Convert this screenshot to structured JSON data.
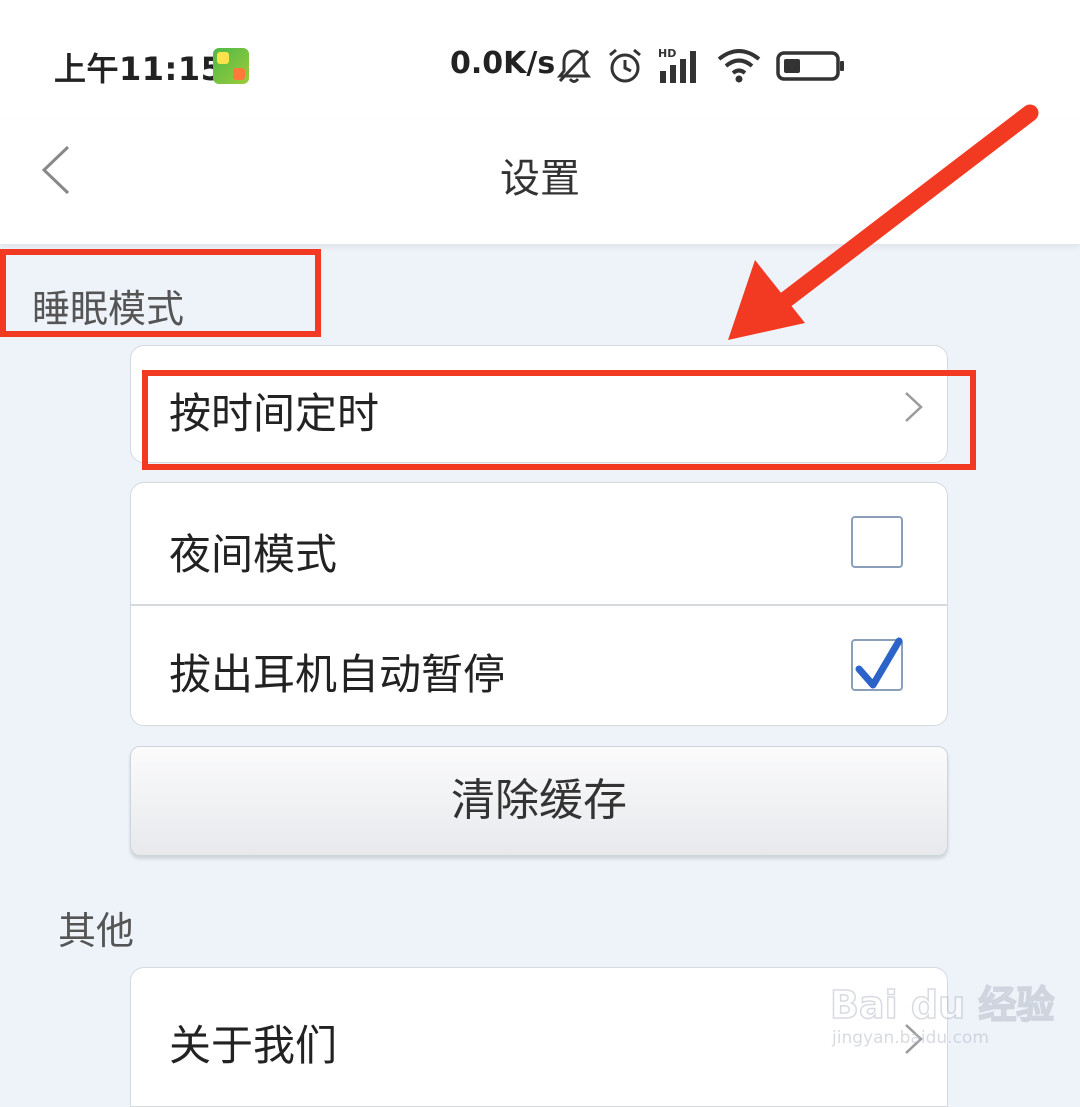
{
  "status_bar": {
    "time": "上午11:15",
    "app_badge_icon": "kids-app-badge-icon",
    "network_speed": "0.0K/s",
    "icons": [
      "bell-off-icon",
      "alarm-clock-icon",
      "hd-signal-icon",
      "wifi-icon",
      "battery-icon"
    ]
  },
  "nav": {
    "title": "设置",
    "back_icon": "chevron-left-icon"
  },
  "sections": {
    "sleep_title": "睡眠模式",
    "other_title": "其他"
  },
  "timer_row": {
    "label": "按时间定时"
  },
  "options": {
    "night_mode": {
      "label": "夜间模式",
      "checked": false
    },
    "pause_on_unplug": {
      "label": "拔出耳机自动暂停",
      "checked": true
    }
  },
  "clear_cache_button": "清除缓存",
  "about_row": {
    "label": "关于我们"
  },
  "watermark": {
    "text": "Bai du 经验",
    "sub": "jingyan.baidu.com"
  },
  "colors": {
    "annotation": "#f23a22",
    "checkmark": "#2b63c8",
    "background": "#eef2f9"
  }
}
